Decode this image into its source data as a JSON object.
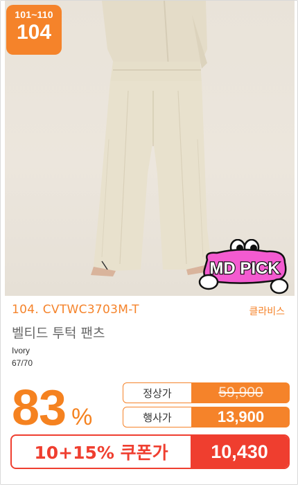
{
  "badge": {
    "range": "101~110",
    "number": "104"
  },
  "sticker": {
    "text": "MD PICK"
  },
  "product": {
    "code": "104. CVTWC3703M-T",
    "brand": "클라비스",
    "name": "벨티드 투턱 팬츠",
    "color": "Ivory",
    "size": "67/70"
  },
  "pricing": {
    "discount": "83",
    "discount_unit": "%",
    "regular_label": "정상가",
    "regular_price": "59,900",
    "event_label": "행사가",
    "event_price": "13,900",
    "coupon_label": "10+15% 쿠폰가",
    "coupon_price": "10,430"
  },
  "colors": {
    "accent": "#f5832a",
    "coupon": "#ef3e2f",
    "sticker_pink": "#f35bd0"
  }
}
